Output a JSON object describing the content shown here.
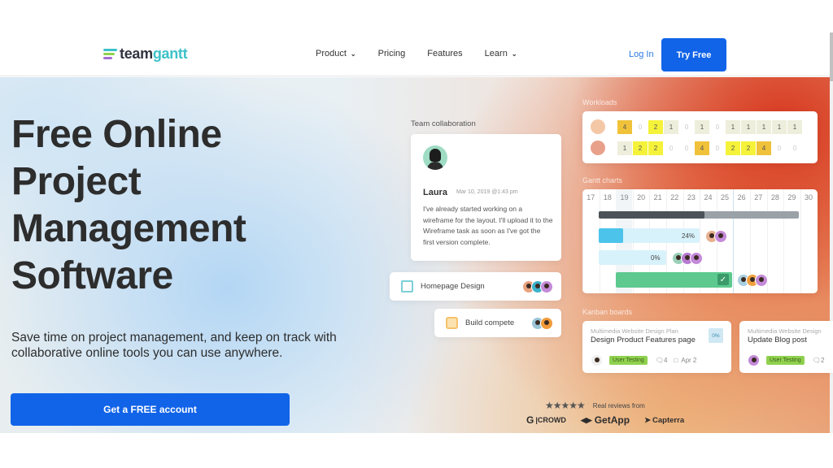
{
  "header": {
    "logo": {
      "part1": "team",
      "part2": "gantt",
      "bar_colors": [
        "#3cc1c9",
        "#8fd14f",
        "#a46dd6"
      ]
    },
    "nav": [
      {
        "label": "Product",
        "has_dropdown": true
      },
      {
        "label": "Pricing",
        "has_dropdown": false
      },
      {
        "label": "Features",
        "has_dropdown": false
      },
      {
        "label": "Learn",
        "has_dropdown": true
      }
    ],
    "login_label": "Log In",
    "try_free_label": "Try Free",
    "chevron_glyph": "⌄"
  },
  "hero": {
    "title_lines": [
      "Free Online",
      "Project",
      "Management",
      "Software"
    ],
    "subtitle": "Save time on project management, and keep on track with collaborative online tools you can use anywhere.",
    "cta_label": "Get a FREE account"
  },
  "collaboration": {
    "section_label": "Team collaboration",
    "comment": {
      "name": "Laura",
      "date": "Mar 10, 2019 @1:43 pm",
      "body": "I've already started working on a wireframe for the layout. I'll upload it to the Wireframe task as soon as I've got the first version complete."
    },
    "tasks": [
      {
        "label": "Homepage Design",
        "icon": "checkbox-icon",
        "icon_color": "#7ccfd6"
      },
      {
        "label": "Build compete",
        "icon": "milestone-icon",
        "icon_color": "#f5c26b"
      }
    ]
  },
  "workloads": {
    "section_label": "Workloads",
    "rows": [
      {
        "values": [
          "4",
          "0",
          "2",
          "1",
          "0",
          "1",
          "0",
          "1",
          "1",
          "1",
          "1",
          "1"
        ]
      },
      {
        "values": [
          "1",
          "2",
          "2",
          "0",
          "0",
          "4",
          "0",
          "2",
          "2",
          "4",
          "0",
          "0"
        ]
      }
    ],
    "colors": {
      "0": "transparent",
      "1": "#eeeedc",
      "2": "#f5f23a",
      "4": "#f0c23a"
    }
  },
  "gantt": {
    "section_label": "Gantt charts",
    "days": [
      "17",
      "18",
      "19",
      "20",
      "21",
      "22",
      "23",
      "24",
      "25",
      "26",
      "27",
      "28",
      "29",
      "30"
    ],
    "bars": [
      {
        "label": "24%",
        "progress": 24
      },
      {
        "label": "0%",
        "progress": 0
      },
      {
        "label": "",
        "progress": 100,
        "complete": true
      }
    ],
    "summary_progress": 53
  },
  "kanban": {
    "section_label": "Kanban boards",
    "cards": [
      {
        "plan": "Multimedia Website Design Plan",
        "title": "Design Product Features page",
        "tag": "User Testing",
        "comments": "4",
        "date": "Apr 2",
        "percent": "0%"
      },
      {
        "plan": "Multimedia Website Design",
        "title": "Update Blog post",
        "tag": "User Testing",
        "comments": "2"
      }
    ]
  },
  "reviews": {
    "stars": "★★★★★",
    "rating": 4.5,
    "text": "Real reviews from",
    "brands": [
      "CROWD",
      "GetApp",
      "Capterra"
    ]
  }
}
